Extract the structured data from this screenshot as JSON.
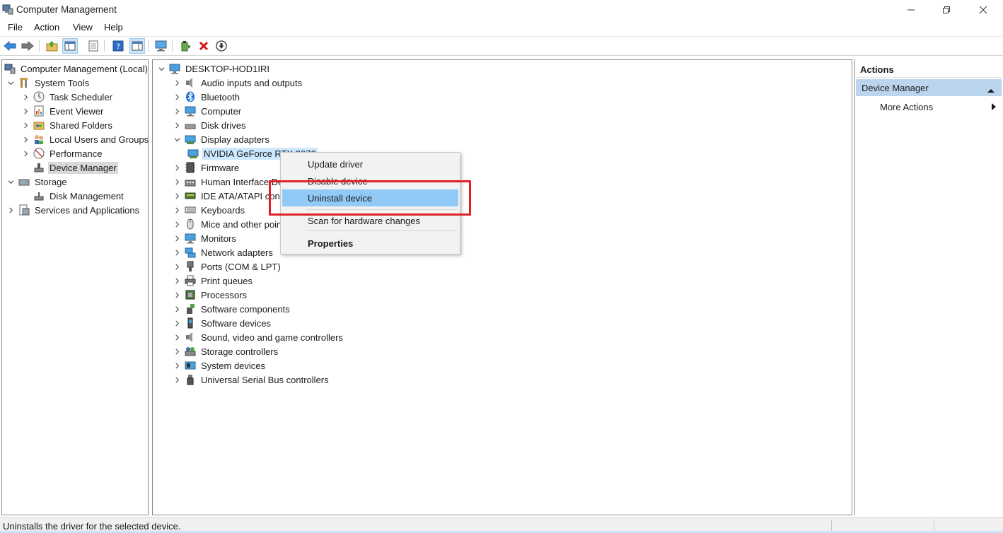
{
  "window": {
    "title": "Computer Management"
  },
  "menu": [
    "File",
    "Action",
    "View",
    "Help"
  ],
  "left_tree": [
    {
      "label": "Computer Management (Local)",
      "icon": "computer-management-icon",
      "expanded": true
    },
    {
      "label": "System Tools",
      "icon": "tools-icon",
      "expanded": true
    },
    {
      "label": "Task Scheduler",
      "icon": "clock-icon",
      "expanded": false
    },
    {
      "label": "Event Viewer",
      "icon": "event-viewer-icon",
      "expanded": false
    },
    {
      "label": "Shared Folders",
      "icon": "shared-folder-icon",
      "expanded": false
    },
    {
      "label": "Local Users and Groups",
      "icon": "users-icon",
      "expanded": false
    },
    {
      "label": "Performance",
      "icon": "performance-icon",
      "expanded": false
    },
    {
      "label": "Device Manager",
      "icon": "device-manager-icon",
      "selected": true
    },
    {
      "label": "Storage",
      "icon": "storage-icon",
      "expanded": true
    },
    {
      "label": "Disk Management",
      "icon": "disk-icon"
    },
    {
      "label": "Services and Applications",
      "icon": "services-icon",
      "expanded": false
    }
  ],
  "device_tree": {
    "root": "DESKTOP-HOD1IRI",
    "categories": [
      {
        "label": "Audio inputs and outputs",
        "icon": "speaker-icon"
      },
      {
        "label": "Bluetooth",
        "icon": "bluetooth-icon"
      },
      {
        "label": "Computer",
        "icon": "monitor-icon"
      },
      {
        "label": "Disk drives",
        "icon": "disk-drive-icon"
      },
      {
        "label": "Display adapters",
        "icon": "display-adapter-icon",
        "expanded": true
      },
      {
        "label": "NVIDIA GeForce RTX 2070",
        "icon": "display-adapter-icon",
        "child": true,
        "selected": true
      },
      {
        "label": "Firmware",
        "icon": "firmware-icon"
      },
      {
        "label": "Human Interface Devices",
        "icon": "hid-icon"
      },
      {
        "label": "IDE ATA/ATAPI controllers",
        "icon": "ide-icon"
      },
      {
        "label": "Keyboards",
        "icon": "keyboard-icon"
      },
      {
        "label": "Mice and other pointing devices",
        "icon": "mouse-icon"
      },
      {
        "label": "Monitors",
        "icon": "monitor-icon"
      },
      {
        "label": "Network adapters",
        "icon": "network-icon"
      },
      {
        "label": "Ports (COM & LPT)",
        "icon": "port-icon"
      },
      {
        "label": "Print queues",
        "icon": "printer-icon"
      },
      {
        "label": "Processors",
        "icon": "processor-icon"
      },
      {
        "label": "Software components",
        "icon": "software-component-icon"
      },
      {
        "label": "Software devices",
        "icon": "software-device-icon"
      },
      {
        "label": "Sound, video and game controllers",
        "icon": "speaker-icon"
      },
      {
        "label": "Storage controllers",
        "icon": "storage-controller-icon"
      },
      {
        "label": "System devices",
        "icon": "system-device-icon"
      },
      {
        "label": "Universal Serial Bus controllers",
        "icon": "usb-icon"
      }
    ]
  },
  "context_menu": {
    "items": [
      "Update driver",
      "Disable device",
      "Uninstall device",
      "Scan for hardware changes",
      "Properties"
    ],
    "hovered": "Uninstall device",
    "highlight_color": "#e3202a"
  },
  "actions_pane": {
    "header": "Actions",
    "section": "Device Manager",
    "more": "More Actions"
  },
  "status": {
    "text": "Uninstalls the driver for the selected device."
  }
}
